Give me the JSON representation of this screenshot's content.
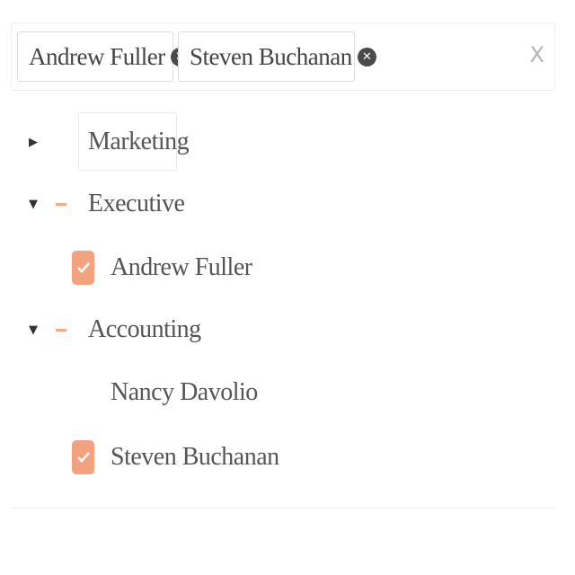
{
  "selected_tags": [
    {
      "label": "Andrew Fuller",
      "remove_icon": "close-circle-icon"
    },
    {
      "label": "Steven Buchanan",
      "remove_icon": "close-circle-icon"
    }
  ],
  "clear_all": {
    "label": "X"
  },
  "tree": {
    "groups": [
      {
        "label": "Marketing",
        "expanded": false,
        "children": []
      },
      {
        "label": "Executive",
        "expanded": true,
        "state": "partial",
        "children": [
          {
            "label": "Andrew Fuller",
            "checked": true
          }
        ]
      },
      {
        "label": "Accounting",
        "expanded": true,
        "state": "partial",
        "children": [
          {
            "label": "Nancy Davolio",
            "checked": false
          },
          {
            "label": "Steven Buchanan",
            "checked": true
          }
        ]
      }
    ]
  },
  "colors": {
    "accent": "#f3a27f",
    "text": "#555555",
    "chip_icon": "#4a4a4a"
  }
}
